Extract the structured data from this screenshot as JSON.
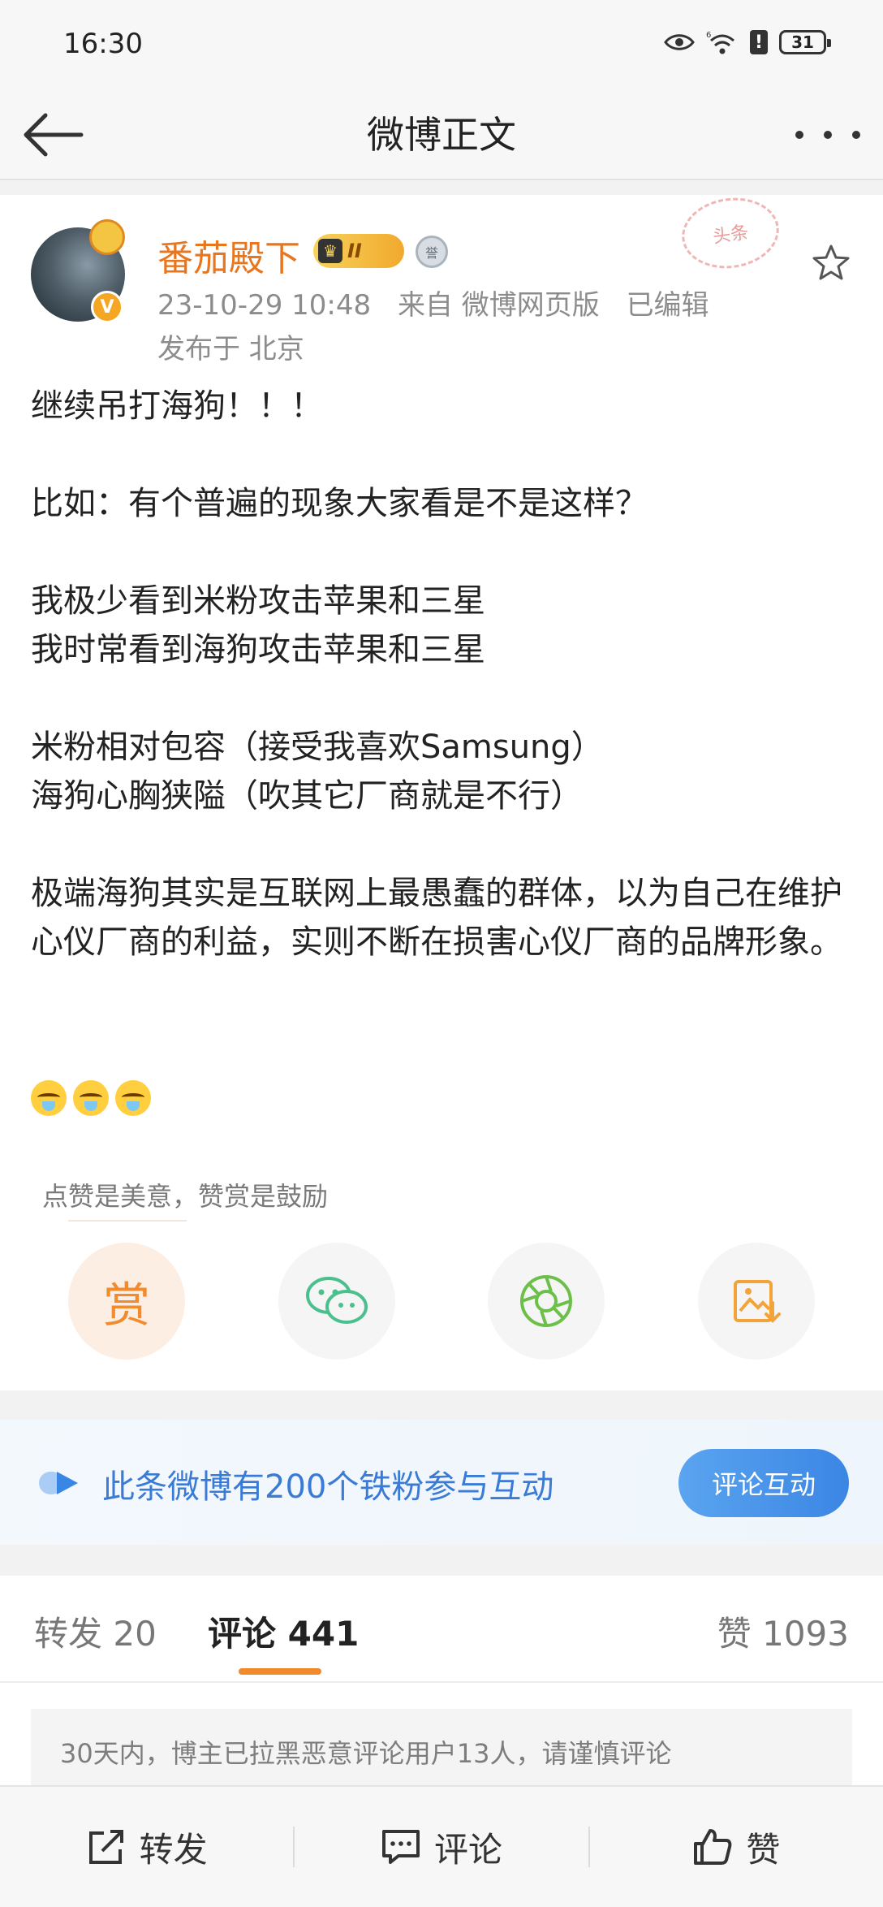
{
  "status_bar": {
    "time": "16:30",
    "signal_label": "6",
    "alert_label": "!",
    "battery": "31"
  },
  "nav": {
    "title": "微博正文"
  },
  "post": {
    "author": "番茄殿下",
    "level_badge": "II",
    "verified_mark": "V",
    "medal_char": "誉",
    "stamp_text": "头条",
    "date": "23-10-29 10:48",
    "source": "来自 微博网页版",
    "edited": "已编辑",
    "location": "发布于 北京",
    "lines": [
      "继续吊打海狗！！！",
      "",
      "比如：有个普遍的现象大家看是不是这样？",
      "",
      "我极少看到米粉攻击苹果和三星",
      "我时常看到海狗攻击苹果和三星",
      "",
      "米粉相对包容（接受我喜欢Samsung）",
      "海狗心胸狭隘（吹其它厂商就是不行）",
      "",
      "极端海狗其实是互联网上最愚蠢的群体，以为自己在维护心仪厂商的利益，实则不断在损害心仪厂商的品牌形象。"
    ],
    "emoji_count": 3,
    "reward_tip": "点赞是美意，赞赏是鼓励",
    "reward_char": "赏"
  },
  "share_buttons": [
    "reward-icon",
    "wechat-icon",
    "moments-icon",
    "save-image-icon"
  ],
  "banner": {
    "text": "此条微博有200个铁粉参与互动",
    "button": "评论互动"
  },
  "tabs": {
    "repost": "转发 20",
    "comment": "评论 441",
    "like": "赞 1093"
  },
  "notice": "30天内，博主已拉黑恶意评论用户13人，请谨慎评论",
  "bottom_bar": {
    "repost": "转发",
    "comment": "评论",
    "like": "赞"
  },
  "colors": {
    "accent_orange": "#f08a2c",
    "username": "#e8761e",
    "banner_blue": "#3a7bd5"
  }
}
